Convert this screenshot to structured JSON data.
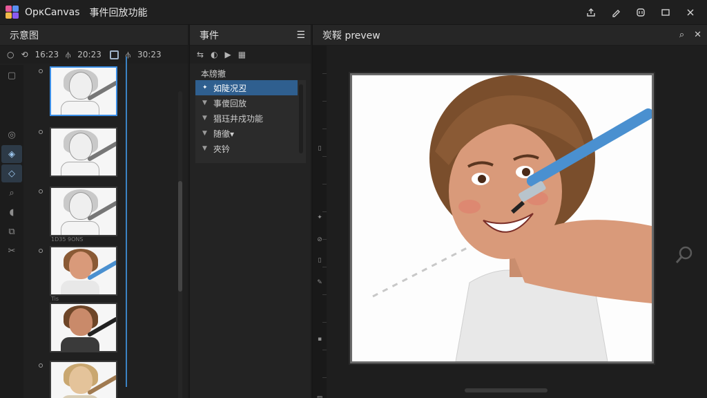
{
  "app": {
    "name": "OpκCanvas",
    "subtitle": "事件回放功能",
    "logo_colors": [
      "#e85a9a",
      "#5a8ff0",
      "#f0b84a",
      "#8a5af0"
    ]
  },
  "window_controls": {
    "share_icon": "share-icon",
    "brush_icon": "brush-icon",
    "badge_icon": "badge-icon",
    "restore_icon": "restore-icon",
    "close_icon": "close-icon"
  },
  "left_panel": {
    "title": "示意图",
    "timeline": {
      "t1": "16:23",
      "t2": "20:23",
      "t3": "30:23"
    },
    "thumb_captions": [
      "1D35 9ONS",
      "Tis"
    ],
    "tools": [
      "brush",
      "fill",
      "eraser",
      "zoom",
      "lasso",
      "layer",
      "cut"
    ]
  },
  "events_panel": {
    "title": "事件",
    "group_label": "本牓撤",
    "items": [
      {
        "label": "如陡况丒",
        "selected": true
      },
      {
        "label": "事傻回放",
        "selected": false
      },
      {
        "label": "猖珏井戍功能",
        "selected": false
      },
      {
        "label": "随徹▾",
        "selected": false
      },
      {
        "label": "夾钤",
        "selected": false
      }
    ]
  },
  "preview_panel": {
    "title": "炭鞖 prevew",
    "search_icon": "search-icon",
    "close_icon": "close-icon"
  },
  "colors": {
    "accent": "#3a8ee6",
    "selection": "#2f5f8f",
    "hair": "#8a5a35",
    "skin": "#d99a7a",
    "brush": "#4a90d0",
    "shirt": "#e8e8e8"
  }
}
